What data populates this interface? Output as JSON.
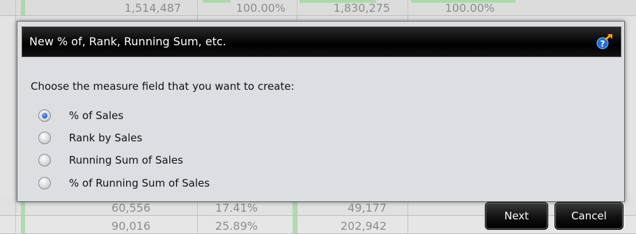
{
  "background_table": {
    "top_row": [
      "1,514,487",
      "100.00%",
      "1,830,275",
      "100.00%"
    ],
    "rows": [
      [
        "60,556",
        "17.41%",
        "49,177"
      ],
      [
        "90,016",
        "25.89%",
        "202,942"
      ]
    ]
  },
  "dialog": {
    "title": "New % of, Rank, Running Sum, etc.",
    "help_icon": "help-question-arrow-icon",
    "prompt": "Choose the measure field that you want to create:",
    "options": [
      {
        "label": "% of Sales",
        "checked": true
      },
      {
        "label": "Rank by Sales",
        "checked": false
      },
      {
        "label": "Running Sum of Sales",
        "checked": false
      },
      {
        "label": "% of Running Sum of Sales",
        "checked": false
      }
    ]
  },
  "buttons": {
    "next": "Next",
    "cancel": "Cancel"
  }
}
